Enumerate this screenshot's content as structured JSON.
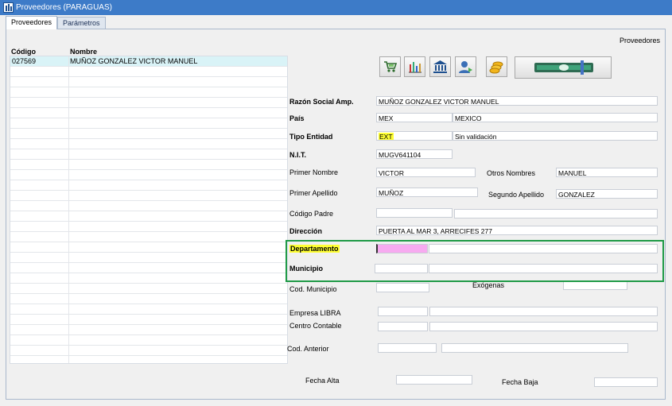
{
  "window": {
    "title": "Proveedores (PARAGUAS)"
  },
  "tabs": [
    "Proveedores",
    "Parámetros"
  ],
  "section_title": "Proveedores",
  "grid": {
    "columns": [
      "Código",
      "Nombre"
    ],
    "rows": [
      {
        "code": "027569",
        "name": "MUÑOZ GONZALEZ VICTOR MANUEL"
      }
    ]
  },
  "toolbar": {
    "icons": [
      "shopping-cart-icon",
      "bar-chart-icon",
      "bank-icon",
      "user-contact-icon",
      "coins-icon",
      "money-bill-icon"
    ]
  },
  "form": {
    "razon_social": {
      "label": "Razón Social Amp.",
      "value": "MUÑOZ GONZALEZ VICTOR MANUEL"
    },
    "pais": {
      "label": "País",
      "code": "MEX",
      "name": "MEXICO"
    },
    "tipo_entidad": {
      "label": "Tipo Entidad",
      "code": "EXT",
      "desc": "Sin validación"
    },
    "nit": {
      "label": "N.I.T.",
      "value": "MUGV641104"
    },
    "primer_nombre": {
      "label": "Primer Nombre",
      "value": "VICTOR"
    },
    "otros_nombres": {
      "label": "Otros Nombres",
      "value": "MANUEL"
    },
    "primer_apellido": {
      "label": "Primer Apellido",
      "value": "MUÑOZ"
    },
    "segundo_apellido": {
      "label": "Segundo Apellido",
      "value": "GONZALEZ"
    },
    "codigo_padre": {
      "label": "Código Padre",
      "code": "",
      "desc": ""
    },
    "direccion": {
      "label": "Dirección",
      "value": "PUERTA AL MAR 3, ARRECIFES 277"
    },
    "departamento": {
      "label": "Departamento",
      "code": "",
      "desc": ""
    },
    "municipio": {
      "label": "Municipio",
      "code": "",
      "desc": ""
    },
    "cod_municipio": {
      "label": "Cod. Municipio",
      "value": ""
    },
    "exogenas": {
      "label": "Exógenas",
      "value": ""
    },
    "empresa_libra": {
      "label": "Empresa LIBRA",
      "code": "",
      "desc": ""
    },
    "centro_contable": {
      "label": "Centro Contable",
      "code": "",
      "desc": ""
    },
    "cod_anterior": {
      "label": "Cod. Anterior",
      "code": "",
      "desc": ""
    },
    "fecha_alta": {
      "label": "Fecha Alta",
      "value": ""
    },
    "fecha_baja": {
      "label": "Fecha Baja",
      "value": ""
    }
  },
  "colors": {
    "titlebar": "#3d7bc8",
    "highlight": "#ffff33",
    "active_field": "#f7aaf0",
    "focus_box": "#1f9a47",
    "selected_row": "#d9f3f7"
  }
}
